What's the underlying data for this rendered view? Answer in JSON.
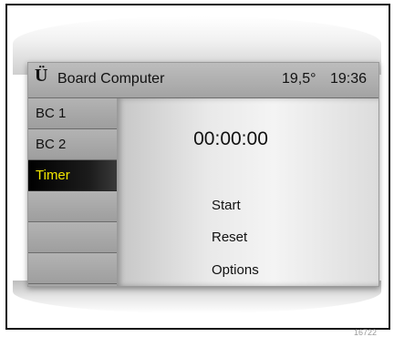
{
  "header": {
    "logo": "Ü",
    "title": "Board Computer",
    "temperature": "19,5°",
    "time": "19:36"
  },
  "sidebar": {
    "items": [
      {
        "label": "BC 1",
        "active": false
      },
      {
        "label": "BC 2",
        "active": false
      },
      {
        "label": "Timer",
        "active": true
      },
      {
        "label": "",
        "active": false
      },
      {
        "label": "",
        "active": false
      },
      {
        "label": "",
        "active": false
      }
    ]
  },
  "main": {
    "timer_value": "00:00:00",
    "actions": [
      "Start",
      "Reset",
      "Options"
    ]
  },
  "footnote": "16722",
  "colors": {
    "active_text": "#f2e600",
    "active_background": "#000000",
    "screen_gray": "#c9c9c9"
  }
}
